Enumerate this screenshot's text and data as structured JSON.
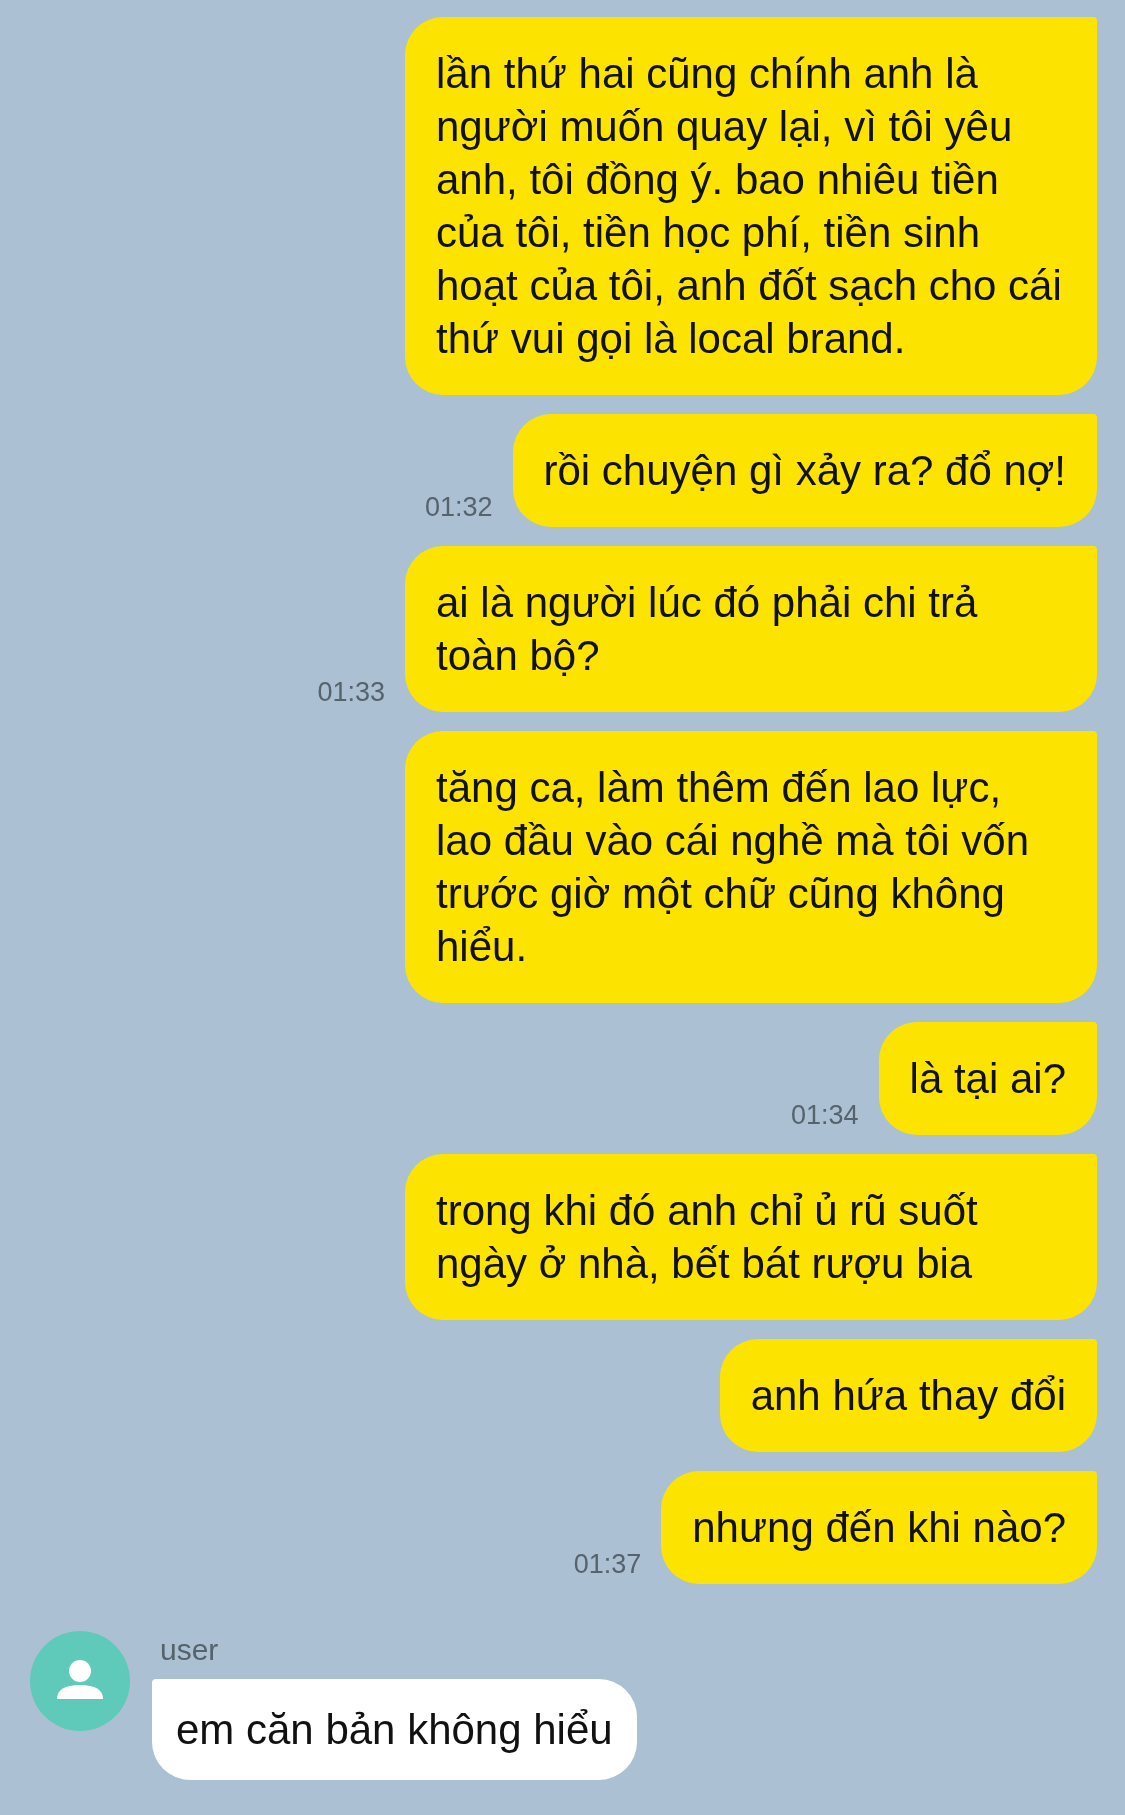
{
  "messages": [
    {
      "kind": "outgoing",
      "text": "lần thứ hai cũng chính anh là người muốn quay lại, vì tôi yêu anh, tôi đồng ý. bao nhiêu tiền của tôi, tiền học phí, tiền sinh hoạt của tôi, anh đốt sạch cho cái thứ vui gọi là local brand."
    },
    {
      "kind": "outgoing",
      "text": "rồi chuyện gì xảy ra? đổ nợ!",
      "time": "01:32"
    },
    {
      "kind": "outgoing",
      "text": "ai là người lúc đó phải chi trả toàn bộ?",
      "time": "01:33"
    },
    {
      "kind": "outgoing",
      "text": "tăng ca, làm thêm đến lao lực, lao đầu vào cái nghề mà tôi vốn trước giờ một chữ cũng không hiểu."
    },
    {
      "kind": "outgoing",
      "text": "là tại ai?",
      "time": "01:34"
    },
    {
      "kind": "outgoing",
      "text": "trong khi đó anh chỉ ủ rũ suốt ngày ở nhà, bết bát rượu bia"
    },
    {
      "kind": "outgoing",
      "text": "anh hứa thay đổi"
    },
    {
      "kind": "outgoing",
      "text": "nhưng đến khi nào?",
      "time": "01:37"
    },
    {
      "kind": "incoming",
      "sender": "user",
      "text": "em căn bản không hiểu"
    }
  ]
}
